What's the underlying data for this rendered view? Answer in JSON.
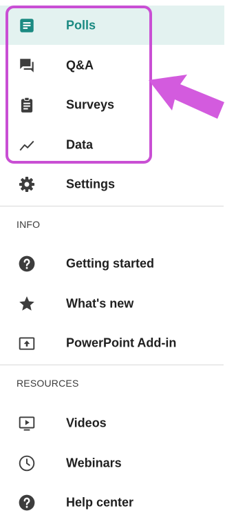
{
  "nav": {
    "items": [
      {
        "label": "Polls",
        "icon": "polls-icon",
        "active": true
      },
      {
        "label": "Q&A",
        "icon": "chat-icon"
      },
      {
        "label": "Surveys",
        "icon": "clipboard-icon"
      },
      {
        "label": "Data",
        "icon": "trend-line-icon"
      },
      {
        "label": "Settings",
        "icon": "gear-icon"
      }
    ]
  },
  "info": {
    "heading": "INFO",
    "items": [
      {
        "label": "Getting started",
        "icon": "help-circle-icon"
      },
      {
        "label": "What's new",
        "icon": "star-icon"
      },
      {
        "label": "PowerPoint Add-in",
        "icon": "upload-box-icon"
      }
    ]
  },
  "resources": {
    "heading": "RESOURCES",
    "items": [
      {
        "label": "Videos",
        "icon": "video-play-icon"
      },
      {
        "label": "Webinars",
        "icon": "clock-icon"
      },
      {
        "label": "Help center",
        "icon": "help-circle-icon"
      }
    ]
  },
  "colors": {
    "active_background": "#e3f2f0",
    "active_accent": "#1b8a82",
    "highlight": "#c94fd4",
    "icon_gray": "#3d3d3d"
  }
}
